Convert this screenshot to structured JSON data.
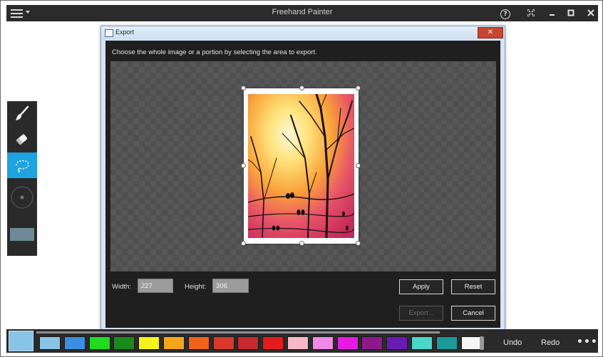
{
  "app": {
    "title": "Freehand Painter",
    "window_controls": {
      "help": "?",
      "fullscreen": "⤧",
      "minimize": "–",
      "maximize": "▪",
      "close": "✕"
    }
  },
  "toolbox": {
    "tools": [
      {
        "name": "brush",
        "icon": "brush-icon",
        "active": false
      },
      {
        "name": "eraser",
        "icon": "eraser-icon",
        "active": false
      },
      {
        "name": "lasso",
        "icon": "lasso-icon",
        "active": true
      },
      {
        "name": "brush-size",
        "icon": "brush-size-icon",
        "active": false
      }
    ],
    "selected_color": "#6f8a96"
  },
  "dialog": {
    "title": "Export",
    "close_label": "✕",
    "instructions": "Choose the whole image or a portion by selecting the area to export.",
    "width_label": "Width:",
    "width_value": "227",
    "height_label": "Height:",
    "height_value": "306",
    "apply_label": "Apply",
    "reset_label": "Reset",
    "export_label": "Export...",
    "cancel_label": "Cancel"
  },
  "palette": {
    "current_color": "#89c3e6",
    "colors": [
      "#89c3e6",
      "#3a8fe0",
      "#1fdc1f",
      "#1a8a1a",
      "#f5f21c",
      "#f6a51a",
      "#f2601a",
      "#d83a2a",
      "#c8282e",
      "#e61a1a",
      "#f7b6c9",
      "#f08ae6",
      "#e61ae0",
      "#8c1a8c",
      "#6a1ab4",
      "#4ad6c8",
      "#1a9a9a",
      "#f6f6f6"
    ],
    "undo_label": "Undo",
    "redo_label": "Redo",
    "more_label": "•••"
  }
}
